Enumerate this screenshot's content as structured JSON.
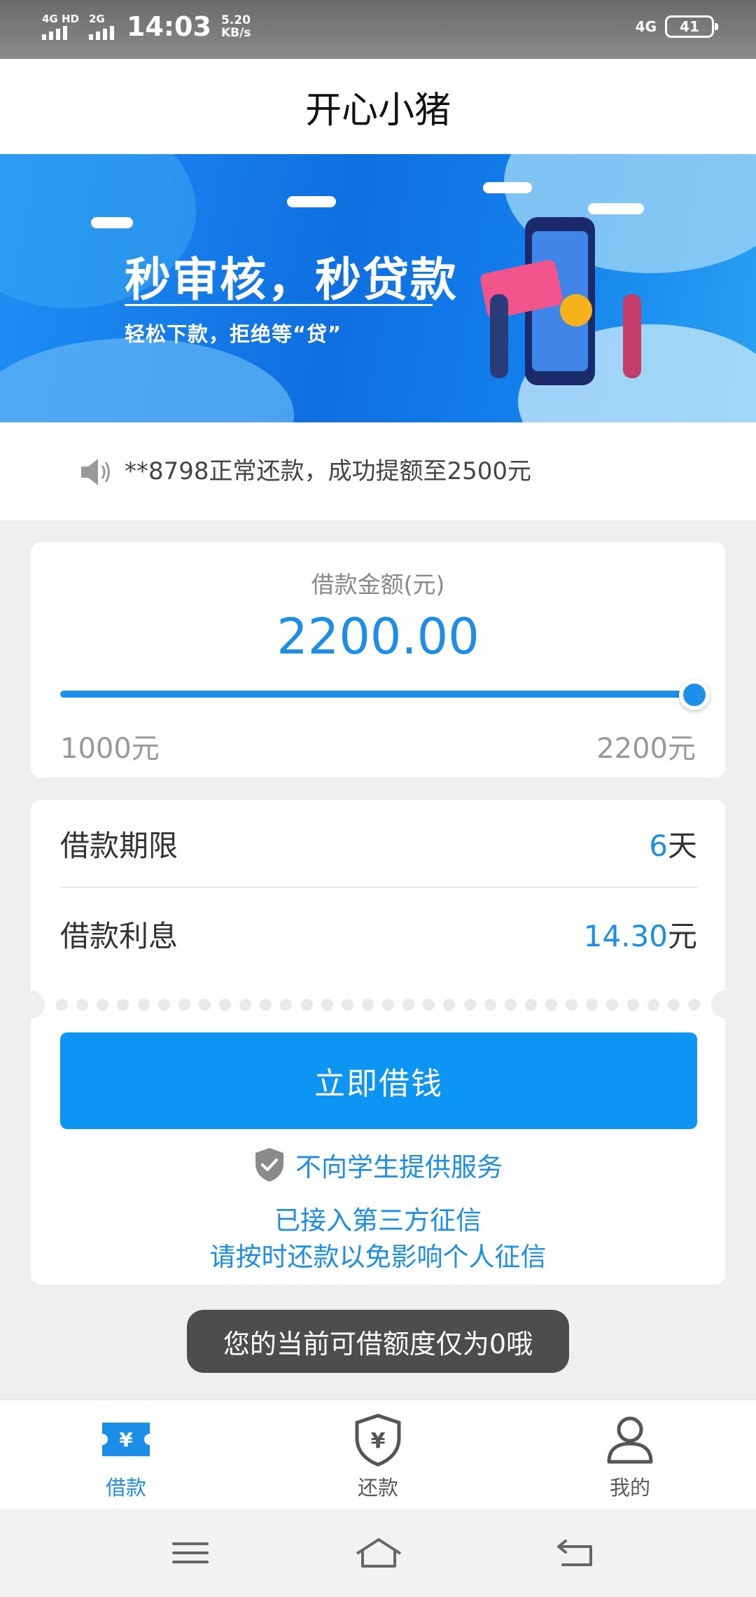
{
  "status_bar": {
    "net1": "4G HD",
    "net2": "2G",
    "time": "14:03",
    "speed_value": "5.20",
    "speed_unit": "KB/s",
    "network_type": "4G",
    "battery": "41"
  },
  "header": {
    "title": "开心小猪"
  },
  "banner": {
    "headline": "秒审核，秒贷款",
    "subtitle": "轻松下款，拒绝等“贷”"
  },
  "notice": {
    "icon": "speaker-icon",
    "text": "**8798正常还款，成功提额至2500元"
  },
  "loan_amount": {
    "label": "借款金额(元)",
    "value": "2200.00",
    "min_label": "1000元",
    "max_label": "2200元",
    "slider_fraction": 1.0
  },
  "details": {
    "term_label": "借款期限",
    "term_value": "6",
    "term_unit": "天",
    "interest_label": "借款利息",
    "interest_value": "14.30",
    "interest_unit": "元"
  },
  "cta": {
    "borrow_label": "立即借钱"
  },
  "notes": {
    "no_students": "不向学生提供服务",
    "credit_line1": "已接入第三方征信",
    "credit_line2": "请按时还款以免影响个人征信"
  },
  "toast": {
    "text": "您的当前可借额度仅为0哦"
  },
  "bottom_nav": {
    "items": [
      {
        "label": "借款",
        "icon": "loan-ticket-icon",
        "active": true
      },
      {
        "label": "还款",
        "icon": "yen-shield-icon",
        "active": false
      },
      {
        "label": "我的",
        "icon": "person-icon",
        "active": false
      }
    ]
  },
  "colors": {
    "accent": "#1b8ee8",
    "button": "#0c95f3",
    "background": "#efefef",
    "toast": "#4d4d4d"
  }
}
